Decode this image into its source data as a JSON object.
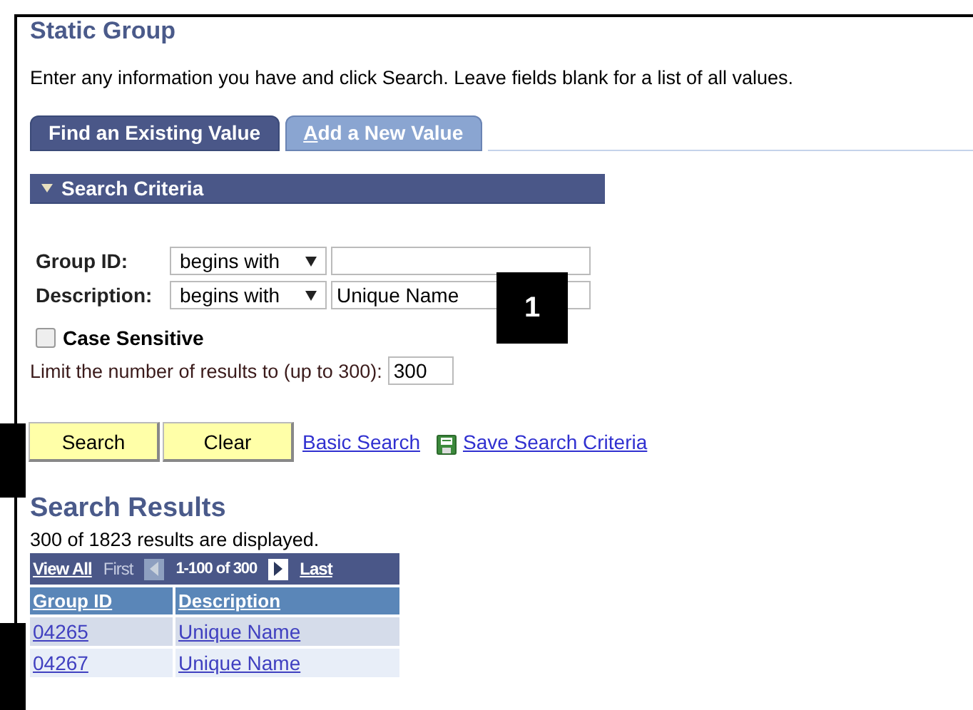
{
  "page": {
    "title": "Static Group",
    "instructions": "Enter any information you have and click Search. Leave fields blank for a list of all values."
  },
  "tabs": [
    {
      "label": "Find an Existing Value",
      "selected": true
    },
    {
      "label": "Add a New Value",
      "selected": false
    }
  ],
  "search_criteria": {
    "heading": "Search Criteria",
    "expanded": true,
    "fields": [
      {
        "label": "Group ID:",
        "operator": "begins with"
      },
      {
        "label": "Description:",
        "operator": "begins with",
        "value": "Unique Name"
      }
    ],
    "case_sensitive": {
      "label": "Case Sensitive",
      "checked": false
    },
    "limit": {
      "label": "Limit the number of results to (up to 300):",
      "value": "300"
    }
  },
  "buttons": [
    "Search",
    "Clear"
  ],
  "links": [
    {
      "label": "Basic Search",
      "kind": "plain"
    },
    {
      "label": "Save Search Criteria",
      "kind": "save"
    }
  ],
  "results": {
    "heading": "Search Results",
    "count": "300 of 1823 results are displayed.",
    "nav": {
      "view_all": "View All",
      "first": {
        "label": "First",
        "disabled": true
      },
      "previous": {
        "disabled": true
      },
      "range": "1-100 of 300",
      "next": {
        "disabled": false
      },
      "last": {
        "label": "Last",
        "disabled": false
      }
    },
    "columns": [
      "Group ID",
      "Description"
    ],
    "rows": [
      [
        "04265",
        "Unique Name"
      ],
      [
        "04267",
        "Unique Name"
      ]
    ]
  },
  "callouts": [
    {
      "kind": "numbered",
      "label": "1"
    },
    {
      "kind": "blank"
    },
    {
      "kind": "blank"
    }
  ]
}
